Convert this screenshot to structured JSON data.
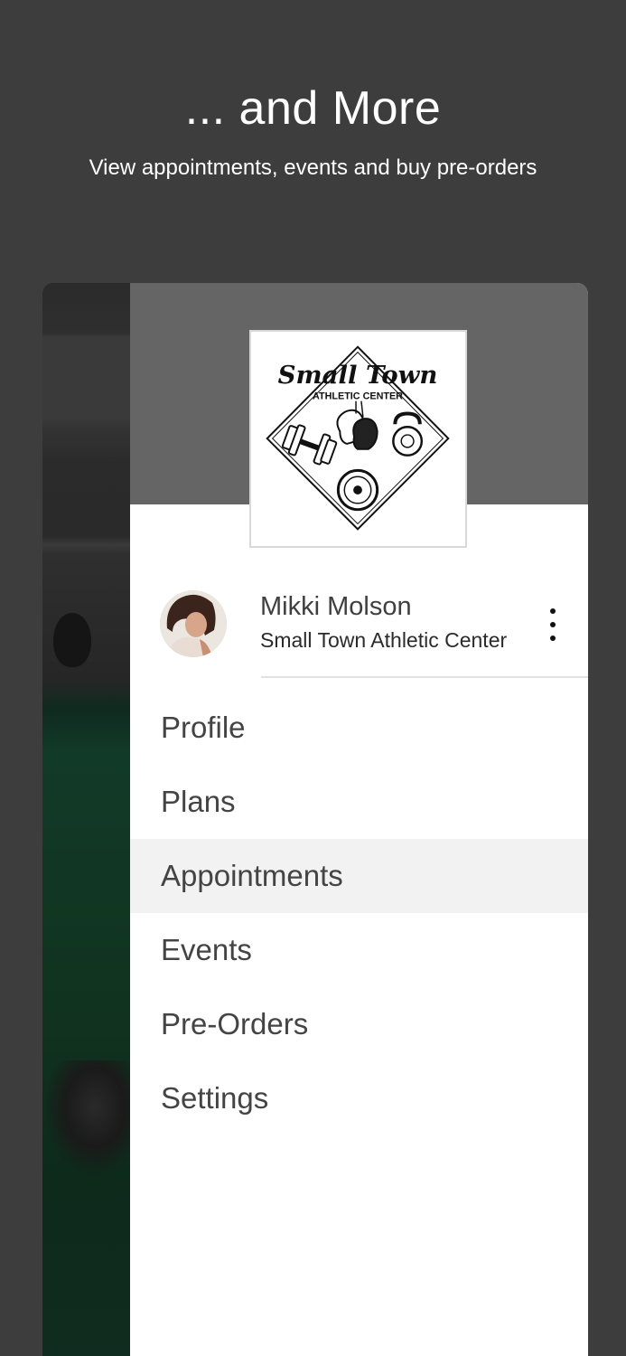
{
  "promo": {
    "title": "... and More",
    "subtitle": "View appointments, events and buy pre-orders"
  },
  "drawer": {
    "logo": {
      "name": "Small Town",
      "tagline": "ATHLETIC CENTER"
    },
    "user": {
      "name": "Mikki Molson",
      "gym": "Small Town Athletic Center"
    },
    "menu": [
      {
        "label": "Profile",
        "active": false
      },
      {
        "label": "Plans",
        "active": false
      },
      {
        "label": "Appointments",
        "active": true
      },
      {
        "label": "Events",
        "active": false
      },
      {
        "label": "Pre-Orders",
        "active": false
      },
      {
        "label": "Settings",
        "active": false
      }
    ]
  },
  "colors": {
    "background": "#3d3d3d",
    "drawer_header": "#656565",
    "active_item": "#f2f2f2"
  },
  "icons": [
    "more-vertical-icon",
    "dumbbell-icon",
    "boxing-gloves-icon",
    "kettlebell-icon",
    "weight-plate-icon"
  ]
}
